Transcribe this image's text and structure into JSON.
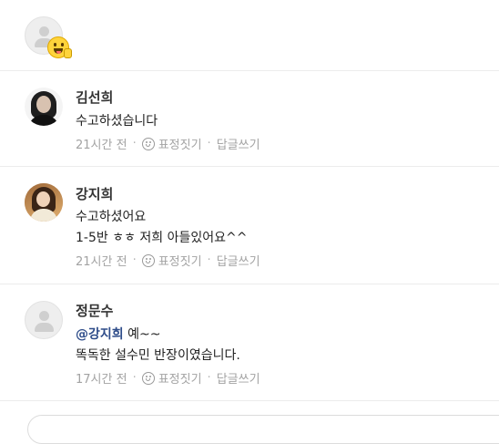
{
  "composer": {
    "avatar": "default-avatar",
    "emoji": "tongue-face-emoji"
  },
  "comments": [
    {
      "author": "김선희",
      "lines": [
        "수고하셨습니다"
      ],
      "time": "21시간 전",
      "react_label": "표정짓기",
      "reply_label": "답글쓰기"
    },
    {
      "author": "강지희",
      "lines": [
        "수고하셨어요",
        "1-5반  ㅎㅎ 저희 아들있어요^^"
      ],
      "time": "21시간 전",
      "react_label": "표정짓기",
      "reply_label": "답글쓰기"
    },
    {
      "author": "정문수",
      "mention": "@강지희",
      "first_line_rest": " 예~~",
      "lines": [
        "똑독한 설수민 반장이였습니다."
      ],
      "time": "17시간 전",
      "react_label": "표정짓기",
      "reply_label": "답글쓰기"
    }
  ],
  "separator": "·"
}
